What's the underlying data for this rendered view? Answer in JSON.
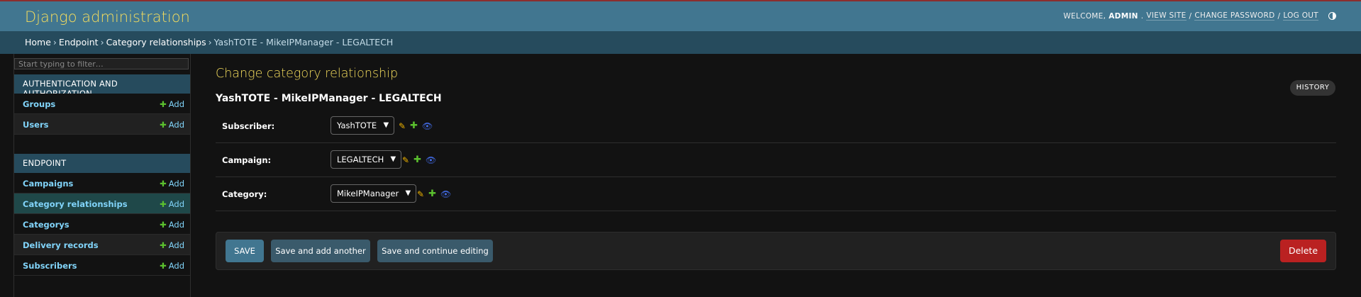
{
  "header": {
    "site_name": "Django administration",
    "welcome": "WELCOME,",
    "username": "ADMIN",
    "view_site": "VIEW SITE",
    "change_password": "CHANGE PASSWORD",
    "log_out": "LOG OUT",
    "sep": "/",
    "theme_icon": "contrast-icon"
  },
  "breadcrumbs": {
    "home": "Home",
    "app": "Endpoint",
    "model": "Category relationships",
    "current": "YashTOTE - MikeIPManager - LEGALTECH",
    "separator": "›"
  },
  "sidebar": {
    "filter_placeholder": "Start typing to filter…",
    "modules": [
      {
        "caption": "AUTHENTICATION AND AUTHORIZATION",
        "models": [
          {
            "name": "Groups",
            "add": "Add"
          },
          {
            "name": "Users",
            "add": "Add"
          }
        ]
      },
      {
        "caption": "ENDPOINT",
        "models": [
          {
            "name": "Campaigns",
            "add": "Add"
          },
          {
            "name": "Category relationships",
            "add": "Add"
          },
          {
            "name": "Categorys",
            "add": "Add"
          },
          {
            "name": "Delivery records",
            "add": "Add"
          },
          {
            "name": "Subscribers",
            "add": "Add"
          }
        ]
      }
    ]
  },
  "content": {
    "title": "Change category relationship",
    "object": "YashTOTE - MikeIPManager - LEGALTECH",
    "history": "HISTORY",
    "fields": [
      {
        "label": "Subscriber:",
        "value": "YashTOTE"
      },
      {
        "label": "Campaign:",
        "value": "LEGALTECH"
      },
      {
        "label": "Category:",
        "value": "MikeIPManager"
      }
    ],
    "buttons": {
      "save": "SAVE",
      "save_add": "Save and add another",
      "save_continue": "Save and continue editing",
      "delete": "Delete"
    }
  },
  "colors": {
    "header_bg": "#417690",
    "breadcrumb_bg": "#264b5d",
    "brand": "#f5dd5d",
    "link": "#81d4fa",
    "add_green": "#5bc02e",
    "delete_red": "#ba2121"
  }
}
